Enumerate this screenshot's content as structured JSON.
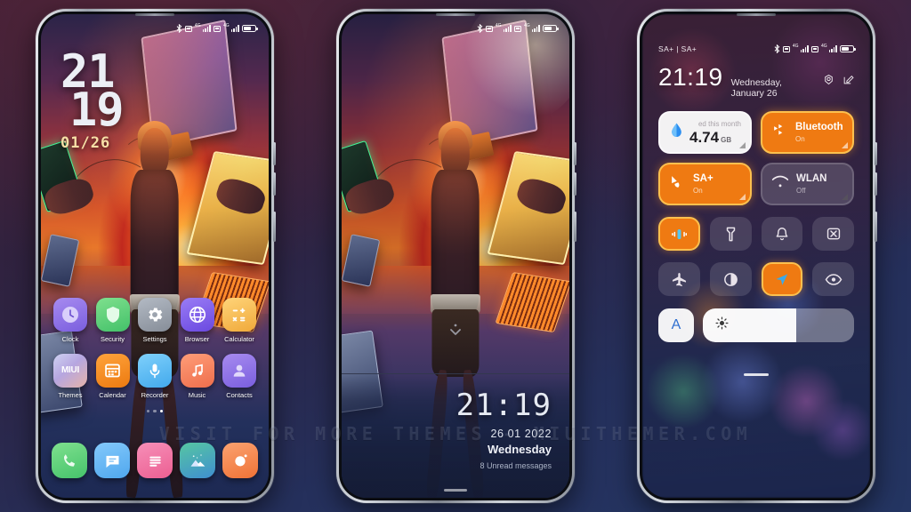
{
  "watermark": "VISIT FOR MORE THEMES - MIUITHEMER.COM",
  "theme": {
    "accent_orange": "#ef7a12",
    "accent_orange_border": "#fcc04e",
    "tile_light": "#ffffff",
    "background_top": "#3b1f33",
    "background_bottom": "#243562"
  },
  "phone1": {
    "name": "lock-screen",
    "status_bar": {
      "bluetooth": "bluetooth-icon",
      "sim1": "sim-4g-signal-icon",
      "sim2": "sim-4g-signal-icon",
      "battery": "battery-icon"
    },
    "clock": {
      "hours": "21",
      "minutes": "19",
      "date": "01/26"
    },
    "apps_row1": [
      {
        "label": "Clock",
        "icon": "clock-icon",
        "color": "#8b6fe0"
      },
      {
        "label": "Security",
        "icon": "shield-icon",
        "color": "#5fd07a"
      },
      {
        "label": "Settings",
        "icon": "gear-icon",
        "color": "#9aa3ae"
      },
      {
        "label": "Browser",
        "icon": "globe-icon",
        "color": "#7b63e8"
      },
      {
        "label": "Calculator",
        "icon": "calculator-icon",
        "color": "#f5b84a"
      }
    ],
    "apps_row2": [
      {
        "label": "Themes",
        "icon": "miui-themes-icon",
        "color": "#9f8fd4"
      },
      {
        "label": "Calendar",
        "icon": "calendar-icon",
        "color": "#f08a1c"
      },
      {
        "label": "Recorder",
        "icon": "microphone-icon",
        "color": "#5bb4ee"
      },
      {
        "label": "Music",
        "icon": "music-note-icon",
        "color": "#f0805f"
      },
      {
        "label": "Contacts",
        "icon": "person-icon",
        "color": "#8b6fe0"
      }
    ],
    "dock": [
      {
        "label": "Phone",
        "icon": "phone-handset-icon",
        "color": "#5fd07a"
      },
      {
        "label": "Messages",
        "icon": "message-bubble-icon",
        "color": "#56b7f5"
      },
      {
        "label": "Notes",
        "icon": "notes-lines-icon",
        "color": "#f070a0"
      },
      {
        "label": "Gallery",
        "icon": "mountain-photo-icon",
        "color": "#4fc2a8"
      },
      {
        "label": "Camera",
        "icon": "camera-lens-icon",
        "color": "#f2833f"
      }
    ],
    "page_dots": {
      "count": 3,
      "active_index": 2
    }
  },
  "phone2": {
    "name": "always-on-display",
    "status_bar": {
      "bluetooth": "bluetooth-icon",
      "sim1": "sim-4g-signal-icon",
      "sim2": "sim-4g-signal-icon",
      "battery": "battery-icon"
    },
    "expand_hint": "chevron-down-icon",
    "time": "21:19",
    "date": "26 01 2022",
    "weekday": "Wednesday",
    "notifications": "8 Unread messages"
  },
  "phone3": {
    "name": "control-center",
    "carrier": "SA+ | SA+",
    "status_bar": {
      "bluetooth": "bluetooth-icon",
      "sim1": "sim-4g-signal-icon",
      "sim2": "sim-4g-signal-icon",
      "battery": "battery-icon"
    },
    "time": "21:19",
    "date": "Wednesday, January 26",
    "header_icons": [
      {
        "name": "settings-gear-icon"
      },
      {
        "name": "edit-pencil-icon"
      }
    ],
    "tiles": [
      {
        "name": "data-usage-tile",
        "label": "ed this month",
        "value": "4.74",
        "unit": "GB",
        "style": "light",
        "icon": "data-drop-icon"
      },
      {
        "name": "bluetooth-tile",
        "title": "Bluetooth",
        "status": "On",
        "style": "on",
        "icon": "bluetooth-arrows-icon"
      },
      {
        "name": "mobile-data-tile",
        "title": "SA+",
        "status": "On",
        "style": "on",
        "icon": "mobile-data-icon"
      },
      {
        "name": "wlan-tile",
        "title": "WLAN",
        "status": "Off",
        "style": "dim",
        "icon": "wifi-icon"
      }
    ],
    "toggles_row1": [
      {
        "name": "sound-vibrate-toggle",
        "icon": "vibrate-icon",
        "active": true
      },
      {
        "name": "flashlight-toggle",
        "icon": "flashlight-icon",
        "active": false
      },
      {
        "name": "silent-toggle",
        "icon": "bell-icon",
        "active": false
      },
      {
        "name": "screen-cast-toggle",
        "icon": "screen-cast-icon",
        "active": false
      }
    ],
    "toggles_row2": [
      {
        "name": "airplane-mode-toggle",
        "icon": "airplane-icon",
        "active": false
      },
      {
        "name": "dark-mode-toggle",
        "icon": "contrast-circle-icon",
        "active": false
      },
      {
        "name": "location-toggle",
        "icon": "location-arrow-icon",
        "active": true
      },
      {
        "name": "reading-mode-toggle",
        "icon": "eye-icon",
        "active": false
      }
    ],
    "brightness": {
      "auto_label": "A",
      "icon": "brightness-sun-icon",
      "percent": 62
    }
  }
}
